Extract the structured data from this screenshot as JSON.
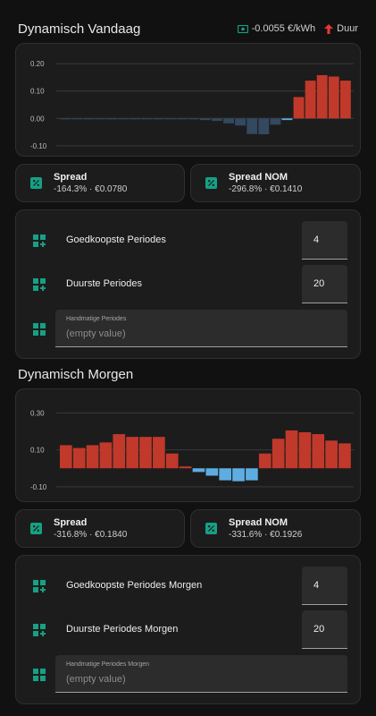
{
  "today": {
    "title": "Dynamisch Vandaag",
    "price_chip": "-0.0055 €/kWh",
    "status_chip": "Duur",
    "chart_data": {
      "type": "bar",
      "ylim": [
        -0.12,
        0.22
      ],
      "y_ticks": [
        "0.20",
        "0.10",
        "0.00",
        "-0.10"
      ],
      "y_tick_values": [
        0.2,
        0.1,
        0.0,
        -0.1
      ],
      "values": [
        -0.001,
        -0.001,
        -0.001,
        -0.001,
        -0.001,
        -0.001,
        -0.001,
        -0.001,
        -0.001,
        -0.001,
        -0.002,
        -0.003,
        -0.006,
        -0.009,
        -0.018,
        -0.026,
        -0.057,
        -0.058,
        -0.023,
        -0.006,
        0.078,
        0.138,
        0.158,
        0.153,
        0.138
      ],
      "colors": {
        "positive": "#c0392b",
        "negative": "#33495f",
        "current": "#5dade2"
      },
      "current_index": 19
    },
    "spread": {
      "title": "Spread",
      "value": "-164.3% · €0.0780"
    },
    "spread_nom": {
      "title": "Spread NOM",
      "value": "-296.8% · €0.1410"
    },
    "cheapest_label": "Goedkoopste Periodes",
    "cheapest_value": "4",
    "expensive_label": "Duurste Periodes",
    "expensive_value": "20",
    "manual_label": "Handmatige Periodes",
    "manual_value": "(empty value)"
  },
  "tomorrow": {
    "title": "Dynamisch Morgen",
    "chart_data": {
      "type": "bar",
      "ylim": [
        -0.12,
        0.35
      ],
      "y_ticks": [
        "0.30",
        "0.10",
        "-0.10"
      ],
      "y_tick_values": [
        0.3,
        0.1,
        -0.1
      ],
      "values": [
        0.125,
        0.11,
        0.125,
        0.14,
        0.185,
        0.17,
        0.17,
        0.17,
        0.08,
        0.01,
        -0.02,
        -0.04,
        -0.065,
        -0.07,
        -0.065,
        0.08,
        0.16,
        0.205,
        0.195,
        0.185,
        0.15,
        0.135
      ],
      "colors": {
        "positive": "#c0392b",
        "negative": "#5dade2"
      }
    },
    "spread": {
      "title": "Spread",
      "value": "-316.8% · €0.1840"
    },
    "spread_nom": {
      "title": "Spread NOM",
      "value": "-331.6% · €0.1926"
    },
    "cheapest_label": "Goedkoopste Periodes Morgen",
    "cheapest_value": "4",
    "expensive_label": "Duurste Periodes Morgen",
    "expensive_value": "20",
    "manual_label": "Handmatige Periodes Morgen",
    "manual_value": "(empty value)"
  }
}
